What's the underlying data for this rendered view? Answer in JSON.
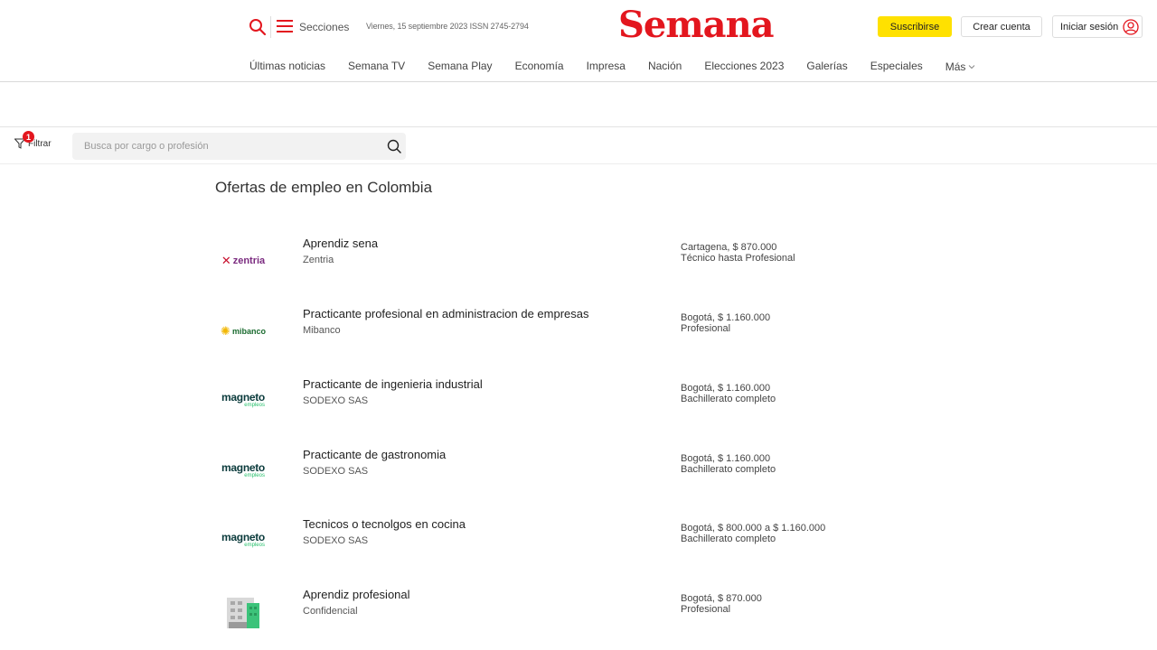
{
  "header": {
    "sections_label": "Secciones",
    "dateline": "Viernes, 15 septiembre 2023 ISSN 2745-2794",
    "logo": "Semana",
    "subscribe_label": "Suscribirse",
    "create_account_label": "Crear cuenta",
    "login_label": "Iniciar sesión",
    "accent_color": "#e3161e",
    "subscribe_color": "#ffe100"
  },
  "nav": {
    "items": [
      {
        "label": "Últimas noticias"
      },
      {
        "label": "Semana TV"
      },
      {
        "label": "Semana Play"
      },
      {
        "label": "Economía"
      },
      {
        "label": "Impresa"
      },
      {
        "label": "Nación"
      },
      {
        "label": "Elecciones 2023"
      },
      {
        "label": "Galerías"
      },
      {
        "label": "Especiales"
      },
      {
        "label": "Más"
      }
    ]
  },
  "filter": {
    "label": "Filtrar",
    "badge_count": "1",
    "search_placeholder": "Busca por cargo o profesión"
  },
  "page": {
    "title": "Ofertas de empleo en Colombia"
  },
  "jobs": [
    {
      "title": "Aprendiz sena",
      "company": "Zentria",
      "location_salary": "Cartagena, $ 870.000",
      "level": "Técnico hasta Profesional",
      "logo": "zentria-logo",
      "logo_text": "zentria"
    },
    {
      "title": "Practicante profesional en administracion de empresas",
      "company": "Mibanco",
      "location_salary": "Bogotá, $ 1.160.000",
      "level": "Profesional",
      "logo": "mibanco-logo",
      "logo_text": "mibanco"
    },
    {
      "title": "Practicante de ingenieria industrial",
      "company": "SODEXO SAS",
      "location_salary": "Bogotá, $ 1.160.000",
      "level": "Bachillerato completo",
      "logo": "magneto-logo",
      "logo_text": "magneto"
    },
    {
      "title": "Practicante de gastronomia",
      "company": "SODEXO SAS",
      "location_salary": "Bogotá, $ 1.160.000",
      "level": "Bachillerato completo",
      "logo": "magneto-logo",
      "logo_text": "magneto"
    },
    {
      "title": "Tecnicos o tecnolgos en cocina",
      "company": "SODEXO SAS",
      "location_salary": "Bogotá, $ 800.000 a $ 1.160.000",
      "level": "Bachillerato completo",
      "logo": "magneto-logo",
      "logo_text": "magneto"
    },
    {
      "title": "Aprendiz profesional",
      "company": "Confidencial",
      "location_salary": "Bogotá, $ 870.000",
      "level": "Profesional",
      "logo": "building-icon"
    }
  ],
  "logo_sub": {
    "magneto": "empleos"
  }
}
